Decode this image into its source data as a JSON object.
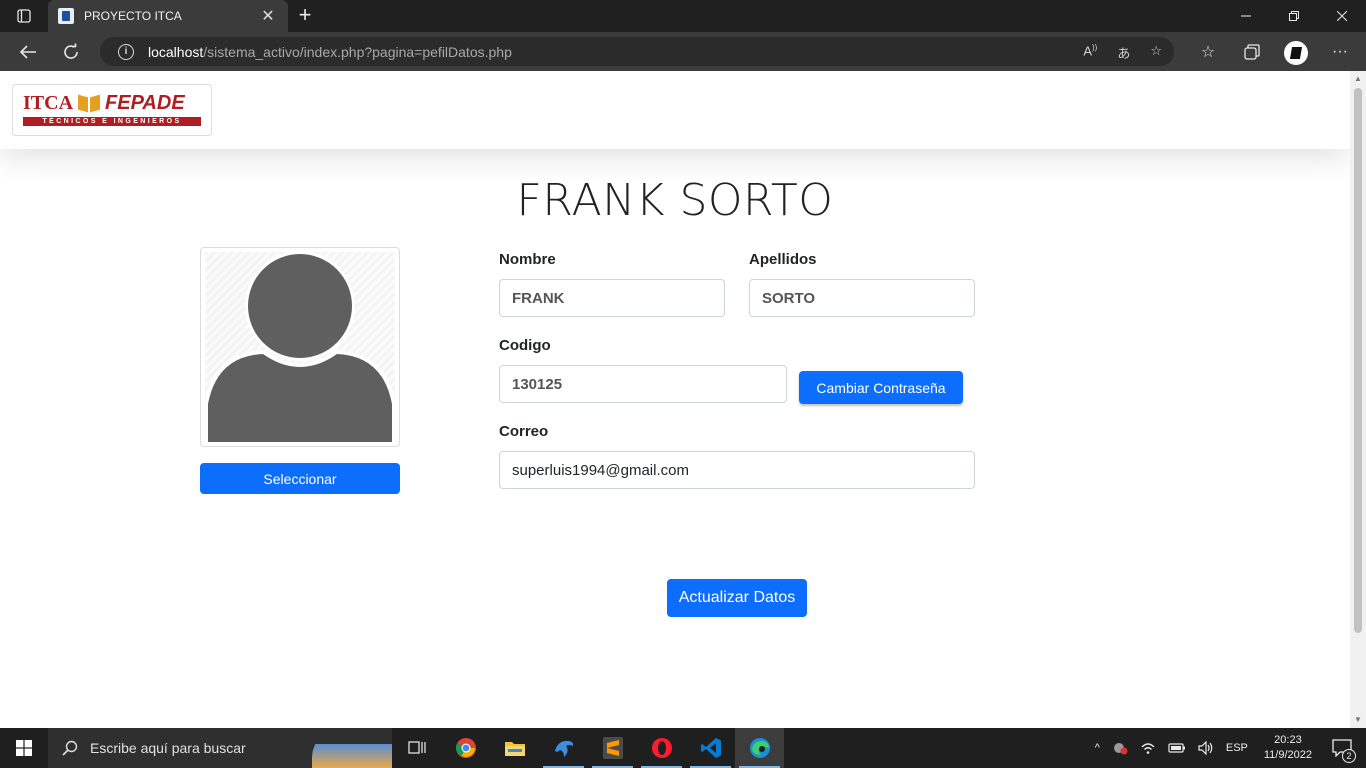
{
  "browser": {
    "tab_title": "PROYECTO ITCA",
    "url_host": "localhost",
    "url_path": "/sistema_activo/index.php?pagina=pefilDatos.php"
  },
  "logo": {
    "brand_left": "ITCA",
    "brand_right": "FEPADE",
    "tagline": "TÉCNICOS E INGENIEROS"
  },
  "profile": {
    "full_name": "FRANK SORTO",
    "select_button": "Seleccionar",
    "avatar_icon": "user-silhouette-icon"
  },
  "form": {
    "nombre_label": "Nombre",
    "nombre_value": "FRANK",
    "apellidos_label": "Apellidos",
    "apellidos_value": "SORTO",
    "codigo_label": "Codigo",
    "codigo_value": "130125",
    "change_password_button": "Cambiar Contraseña",
    "correo_label": "Correo",
    "correo_value": "superluis1994@gmail.com",
    "update_button": "Actualizar Datos"
  },
  "taskbar": {
    "search_placeholder": "Escribe aquí para buscar",
    "language": "ESP",
    "time": "20:23",
    "date": "11/9/2022",
    "notification_count": "2"
  },
  "colors": {
    "primary": "#0d6efd",
    "brand_red": "#b01e23",
    "brand_gold": "#e5a020"
  }
}
